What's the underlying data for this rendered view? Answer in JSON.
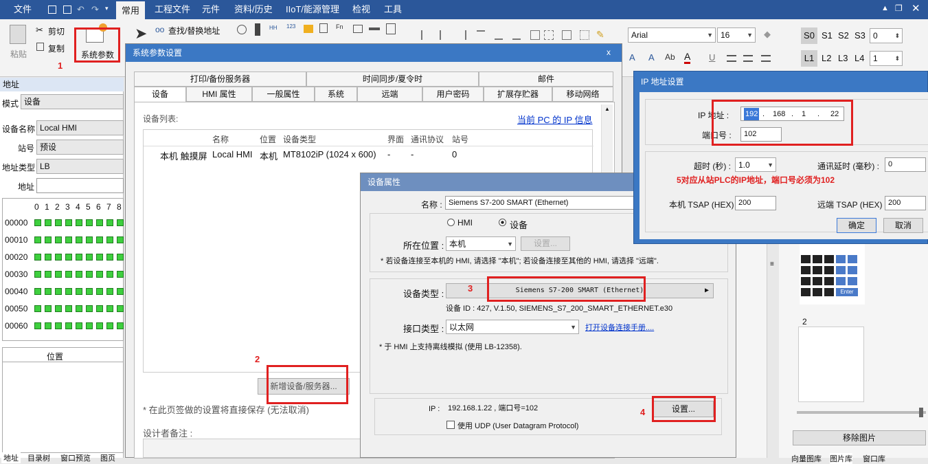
{
  "menubar": {
    "items": [
      "文件",
      "常用",
      "工程文件",
      "元件",
      "资料/历史",
      "IIoT/能源管理",
      "检视",
      "工具"
    ]
  },
  "ribbon": {
    "paste_label": "粘贴",
    "cut_label": "剪切",
    "copy_label": "复制",
    "sysparam_label": "系统参数",
    "find_replace_label": "查找/替换地址",
    "font_name": "Arial",
    "font_size": "16",
    "s_labels": [
      "S0",
      "S1",
      "S2",
      "S3"
    ],
    "s_value": "0",
    "l_labels": [
      "L1",
      "L2",
      "L3",
      "L4"
    ],
    "l_value": "1"
  },
  "leftpanel": {
    "header": "地址",
    "mode_label": "模式",
    "mode_value": "设备",
    "devname_label": "设备名称",
    "devname_value": "Local HMI",
    "station_label": "站号",
    "station_value": "预设",
    "addrtype_label": "地址类型",
    "addrtype_value": "LB",
    "addr_label": "地址",
    "addr_value": "",
    "col_headers": [
      "0",
      "1",
      "2",
      "3",
      "4",
      "5",
      "6",
      "7",
      "8"
    ],
    "rows": [
      "00000",
      "00010",
      "00020",
      "00030",
      "00040",
      "00050",
      "00060"
    ],
    "position_header": "位置",
    "bottom_tabs": [
      "地址",
      "目录树",
      "窗口预览",
      "图页"
    ]
  },
  "sysdlg": {
    "title": "系统参数设置",
    "close": "x",
    "tabs_row1": [
      "打印/备份服务器",
      "时间同步/夏令时",
      "邮件"
    ],
    "tabs_row2": [
      "设备",
      "HMI 属性",
      "一般属性",
      "系统",
      "远端",
      "用户密码",
      "扩展存贮器",
      "移动网络"
    ],
    "devlist_label": "设备列表:",
    "pc_ip_link": "当前 PC 的 IP 信息",
    "table_headers": [
      "名称",
      "位置",
      "设备类型",
      "界面",
      "通讯协议",
      "站号"
    ],
    "table_row": {
      "rowhdr": "本机 触摸屏",
      "name": "Local HMI",
      "loc": "本机",
      "type": "MT8102iP (1024 x 600)",
      "iface": "-",
      "proto": "-",
      "station": "0"
    },
    "add_device_btn": "新增设备/服务器...",
    "note": "* 在此页签做的设置将直接保存 (无法取消)",
    "designer_note_label": "设计者备注 :"
  },
  "devprop": {
    "title": "设备属性",
    "name_label": "名称 :",
    "name_value": "Siemens S7-200 SMART (Ethernet)",
    "radio_hmi": "HMI",
    "radio_device": "设备",
    "location_label": "所在位置 :",
    "location_value": "本机",
    "location_settings_btn": "设置...",
    "location_note": "* 若设备连接至本机的 HMI, 请选择 \"本机\"; 若设备连接至其他的 HMI, 请选择 \"远端\".",
    "devtype_label": "设备类型 :",
    "devtype_value": "Siemens S7-200 SMART (Ethernet)",
    "devid_text": "设备 ID : 427, V.1.50, SIEMENS_S7_200_SMART_ETHERNET.e30",
    "iftype_label": "接口类型 :",
    "iftype_value": "以太网",
    "manual_link": "打开设备连接手册....",
    "offline_note": "* 于 HMI 上支持离线模拟 (使用 LB-12358).",
    "ip_label": "IP :",
    "ip_value": "192.168.1.22 , 端口号=102",
    "ip_settings_btn": "设置...",
    "udp_label": "使用 UDP (User Datagram Protocol)"
  },
  "ipdlg": {
    "title": "IP 地址设置",
    "ip_label": "IP 地址 :",
    "ip_octets": [
      "192",
      "168",
      "1",
      "22"
    ],
    "port_label": "端口号 :",
    "port_value": "102",
    "timeout_label": "超时 (秒) :",
    "timeout_value": "1.0",
    "delay_label": "通讯延时 (毫秒) :",
    "delay_value": "0",
    "local_tsap_label": "本机 TSAP (HEX) :",
    "local_tsap_value": "200",
    "remote_tsap_label": "远端 TSAP (HEX) :",
    "remote_tsap_value": "200",
    "ok_btn": "确定",
    "cancel_btn": "取消"
  },
  "annotations": {
    "n1": "1",
    "n2": "2",
    "n3": "3",
    "n4": "4",
    "note5": "5对应从站PLC的IP地址，端口号必须为102"
  },
  "rightpanel": {
    "keypad_label": "2",
    "remove_image_btn": "移除图片",
    "bottom_tabs": [
      "向量图库",
      "图片库",
      "窗口库"
    ],
    "keypad_enter": "Enter"
  },
  "colors": {
    "accent": "#2b579a",
    "annotation": "#e02020",
    "led": "#3ecf3e"
  }
}
